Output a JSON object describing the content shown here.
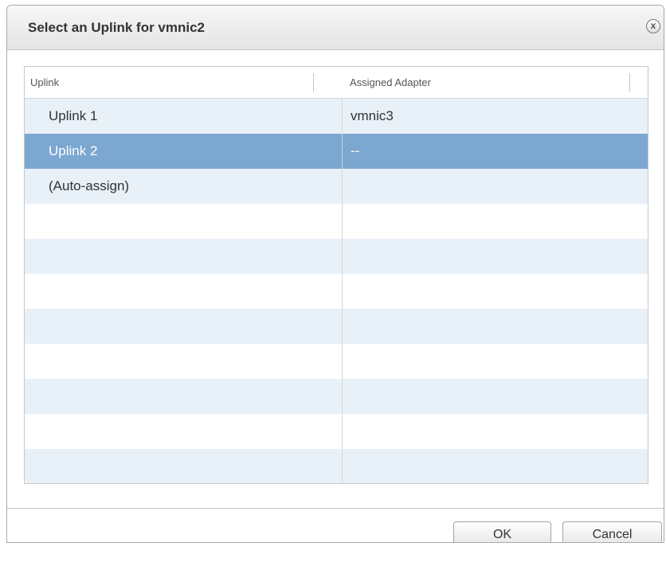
{
  "dialog": {
    "title": "Select an Uplink for vmnic2",
    "close_label": "x"
  },
  "table": {
    "columns": [
      "Uplink",
      "Assigned Adapter"
    ],
    "rows": [
      {
        "uplink": "Uplink 1",
        "adapter": "vmnic3",
        "selected": false
      },
      {
        "uplink": "Uplink 2",
        "adapter": "--",
        "selected": true
      },
      {
        "uplink": "(Auto-assign)",
        "adapter": "",
        "selected": false
      }
    ]
  },
  "buttons": {
    "ok": "OK",
    "cancel": "Cancel"
  },
  "colors": {
    "selected_row": "#7ba7d1",
    "alt_row": "#e8f0f8"
  }
}
